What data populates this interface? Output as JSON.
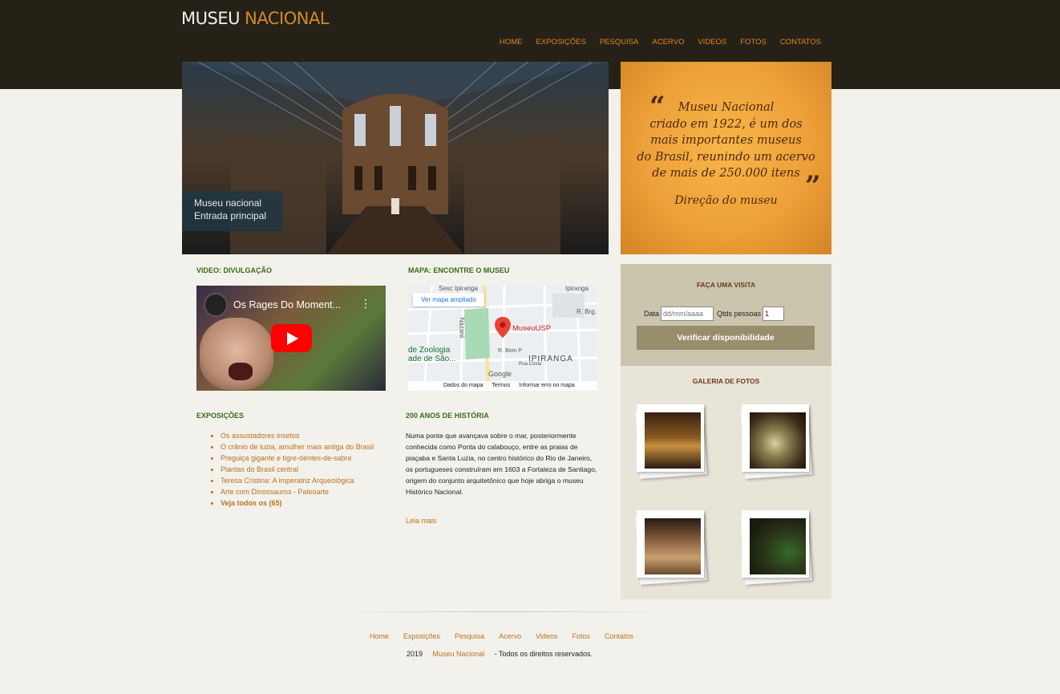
{
  "header": {
    "logo_white": "MUSEU",
    "logo_orange": "NACIONAL",
    "nav": [
      "HOME",
      "EXPOSIÇÕES",
      "PESQUISA",
      "ACERVO",
      "VIDEOS",
      "FOTOS",
      "CONTATOS"
    ]
  },
  "hero": {
    "caption_line1": "Museu nacional",
    "caption_line2": "Entrada principal"
  },
  "quote": {
    "open_mark": "“",
    "close_mark": "”",
    "lines": [
      "Museu Nacional",
      "criado em 1922, é um dos",
      "mais importantes museus",
      "do Brasil, reunindo um acervo",
      "de mais de 250.000 itens"
    ],
    "signature": "Direção do museu"
  },
  "video": {
    "section_title": "VIDEO: DIVULGAÇÃO",
    "title": "Os Rages Do Moment..."
  },
  "map": {
    "section_title": "MAPA: ENCONTRE O MUSEU",
    "link": "Ver mapa ampliado",
    "marker": "MuseuUSP",
    "labels": [
      "Sesc Ipiranga",
      "Ipiranga",
      "Nazaré",
      "R. Brg.",
      "de Zoologia",
      "ade de São...",
      "R. Bom P",
      "Rua Costa",
      "IPIRANGA",
      "Google"
    ],
    "footer": [
      "Dados do mapa",
      "Termos",
      "Informar erro no mapa"
    ]
  },
  "exposicoes": {
    "section_title": "EXPOSIÇÕES",
    "items": [
      "Os assustadores insetos",
      "O crânio de luzia, amulher mais antiga do Brasil",
      "Preguiça gigante e tigre-dentes-de-sabre",
      "Plantas do Brasil central",
      "Teresa Cristina: A imperatriz Arqueológica",
      "Arte com Dinossauros - Paleoarte"
    ],
    "see_all": "Veja todos os (65)"
  },
  "historia": {
    "section_title": "200 ANOS DE HISTÓRIA",
    "text": "Numa ponte que avançava sobre o mar, posteriormente conhecida como Ponta do calabouço, entre as praias de piaçaba e Santa Luzia, no centro histórico do Rio de Janeiro, os portugueses construíram em 1603 a Fortaleza de Santiago, origem do conjunto arquitetônico que hoje abriga o museu Histórico Nacional.",
    "read_more": "Leia mais"
  },
  "visita": {
    "title": "FAÇA UMA VISITA",
    "date_label": "Data",
    "date_placeholder": "dd/mm/aaaa",
    "people_label": "Qtds pessoas",
    "people_value": "1",
    "button": "Verificar disponibilidade"
  },
  "galeria": {
    "title": "GALERIA DE FOTOS"
  },
  "footer": {
    "nav": [
      "Home",
      "Exposições",
      "Pesquisa",
      "Acervo",
      "Videos",
      "Fotos",
      "Contatos"
    ],
    "year": "2019",
    "brand": "Museu Nacional",
    "rights": "- Todos os direitos reservados."
  },
  "colors": {
    "header_bg": "#262117",
    "accent_orange": "#d9861e",
    "section_green": "#3a6b1c",
    "link_brown": "#b8731a",
    "visit_bg": "#ccc5ae",
    "gallery_bg": "#e8e4d8",
    "button_bg": "#988d6c"
  }
}
